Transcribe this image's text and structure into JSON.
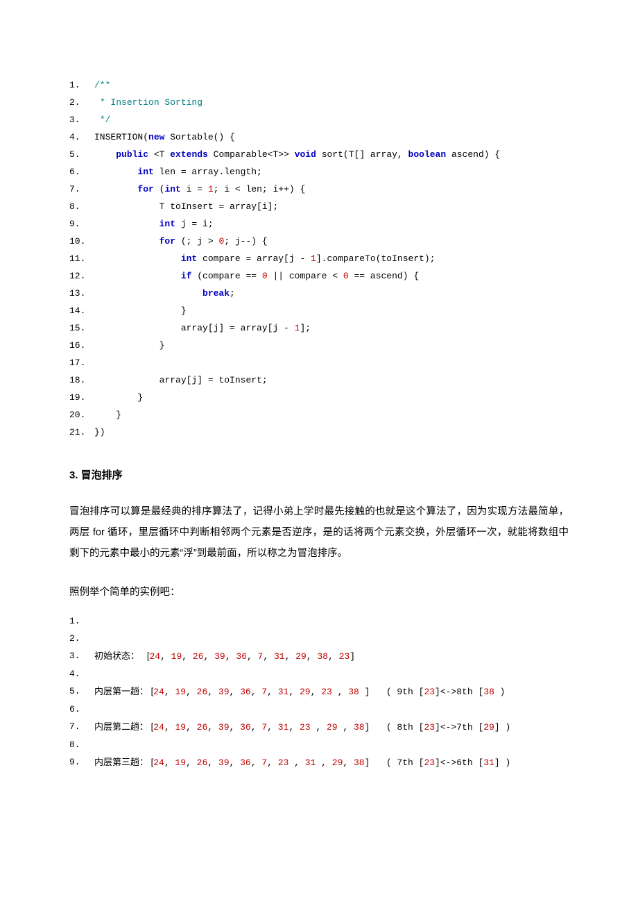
{
  "code1": {
    "lines": [
      {
        "n": "1.",
        "segs": [
          {
            "t": "/**",
            "c": "cmt"
          }
        ]
      },
      {
        "n": "2.",
        "segs": [
          {
            "t": " * Insertion Sorting",
            "c": "cmt"
          }
        ]
      },
      {
        "n": "3.",
        "segs": [
          {
            "t": " */",
            "c": "cmt"
          }
        ]
      },
      {
        "n": "4.",
        "segs": [
          {
            "t": "INSERTION("
          },
          {
            "t": "new",
            "c": "kw"
          },
          {
            "t": " Sortable() {"
          }
        ]
      },
      {
        "n": "5.",
        "segs": [
          {
            "t": "    "
          },
          {
            "t": "public",
            "c": "kw"
          },
          {
            "t": " <T "
          },
          {
            "t": "extends",
            "c": "kw"
          },
          {
            "t": " Comparable<T>> "
          },
          {
            "t": "void",
            "c": "kw"
          },
          {
            "t": " sort(T[] array, "
          },
          {
            "t": "boolean",
            "c": "kw"
          },
          {
            "t": " ascend) {"
          }
        ]
      },
      {
        "n": "6.",
        "segs": [
          {
            "t": "        "
          },
          {
            "t": "int",
            "c": "kw"
          },
          {
            "t": " len = array.length;"
          }
        ]
      },
      {
        "n": "7.",
        "segs": [
          {
            "t": "        "
          },
          {
            "t": "for",
            "c": "kw"
          },
          {
            "t": " ("
          },
          {
            "t": "int",
            "c": "kw"
          },
          {
            "t": " i = "
          },
          {
            "t": "1",
            "c": "num"
          },
          {
            "t": "; i < len; i++) {"
          }
        ]
      },
      {
        "n": "8.",
        "segs": [
          {
            "t": "            T toInsert = array[i];"
          }
        ]
      },
      {
        "n": "9.",
        "segs": [
          {
            "t": "            "
          },
          {
            "t": "int",
            "c": "kw"
          },
          {
            "t": " j = i;"
          }
        ]
      },
      {
        "n": "10.",
        "segs": [
          {
            "t": "            "
          },
          {
            "t": "for",
            "c": "kw"
          },
          {
            "t": " (; j > "
          },
          {
            "t": "0",
            "c": "num"
          },
          {
            "t": "; j--) {"
          }
        ]
      },
      {
        "n": "11.",
        "segs": [
          {
            "t": "                "
          },
          {
            "t": "int",
            "c": "kw"
          },
          {
            "t": " compare = array[j - "
          },
          {
            "t": "1",
            "c": "num"
          },
          {
            "t": "].compareTo(toInsert);"
          }
        ]
      },
      {
        "n": "12.",
        "segs": [
          {
            "t": "                "
          },
          {
            "t": "if",
            "c": "kw"
          },
          {
            "t": " (compare == "
          },
          {
            "t": "0",
            "c": "num"
          },
          {
            "t": " || compare < "
          },
          {
            "t": "0",
            "c": "num"
          },
          {
            "t": " == ascend) {"
          }
        ]
      },
      {
        "n": "13.",
        "segs": [
          {
            "t": "                    "
          },
          {
            "t": "break",
            "c": "kw"
          },
          {
            "t": ";"
          }
        ]
      },
      {
        "n": "14.",
        "segs": [
          {
            "t": "                }"
          }
        ]
      },
      {
        "n": "15.",
        "segs": [
          {
            "t": "                array[j] = array[j - "
          },
          {
            "t": "1",
            "c": "num"
          },
          {
            "t": "];"
          }
        ]
      },
      {
        "n": "16.",
        "segs": [
          {
            "t": "            }"
          }
        ]
      },
      {
        "n": "17.",
        "segs": [
          {
            "t": ""
          }
        ]
      },
      {
        "n": "18.",
        "segs": [
          {
            "t": "            array[j] = toInsert;"
          }
        ]
      },
      {
        "n": "19.",
        "segs": [
          {
            "t": "        }"
          }
        ]
      },
      {
        "n": "20.",
        "segs": [
          {
            "t": "    }"
          }
        ]
      },
      {
        "n": "21.",
        "segs": [
          {
            "t": "})"
          }
        ]
      }
    ]
  },
  "section": {
    "title": "3.  冒泡排序",
    "para1": "冒泡排序可以算是最经典的排序算法了，记得小弟上学时最先接触的也就是这个算法了，因为实现方法最简单，两层 for 循环，里层循环中判断相邻两个元素是否逆序，是的话将两个元素交换，外层循环一次，就能将数组中剩下的元素中最小的元素“浮”到最前面，所以称之为冒泡排序。",
    "para2": "照例举个简单的实例吧："
  },
  "trace": {
    "lines": [
      {
        "n": "1.",
        "segs": []
      },
      {
        "n": "2.",
        "segs": []
      },
      {
        "n": "3.",
        "segs": [
          {
            "t": "初始状态：   [",
            "c": "trlabel"
          },
          {
            "t": "24",
            "c": "num"
          },
          {
            "t": ", "
          },
          {
            "t": "19",
            "c": "num"
          },
          {
            "t": ", "
          },
          {
            "t": "26",
            "c": "num"
          },
          {
            "t": ", "
          },
          {
            "t": "39",
            "c": "num"
          },
          {
            "t": ", "
          },
          {
            "t": "36",
            "c": "num"
          },
          {
            "t": ", "
          },
          {
            "t": "7",
            "c": "num"
          },
          {
            "t": ", "
          },
          {
            "t": "31",
            "c": "num"
          },
          {
            "t": ", "
          },
          {
            "t": "29",
            "c": "num"
          },
          {
            "t": ", "
          },
          {
            "t": "38",
            "c": "num"
          },
          {
            "t": ", "
          },
          {
            "t": "23",
            "c": "num"
          },
          {
            "t": "]"
          }
        ]
      },
      {
        "n": "4.",
        "segs": []
      },
      {
        "n": "5.",
        "segs": [
          {
            "t": "内层第一趟： [",
            "c": "trlabel"
          },
          {
            "t": "24",
            "c": "num"
          },
          {
            "t": ", "
          },
          {
            "t": "19",
            "c": "num"
          },
          {
            "t": ", "
          },
          {
            "t": "26",
            "c": "num"
          },
          {
            "t": ", "
          },
          {
            "t": "39",
            "c": "num"
          },
          {
            "t": ", "
          },
          {
            "t": "36",
            "c": "num"
          },
          {
            "t": ", "
          },
          {
            "t": "7",
            "c": "num"
          },
          {
            "t": ", "
          },
          {
            "t": "31",
            "c": "num"
          },
          {
            "t": ", "
          },
          {
            "t": "29",
            "c": "num"
          },
          {
            "t": ", "
          },
          {
            "t": "23",
            "c": "num"
          },
          {
            "t": " , "
          },
          {
            "t": "38",
            "c": "num"
          },
          {
            "t": " ]   ( 9th ["
          },
          {
            "t": "23",
            "c": "num"
          },
          {
            "t": "]<->8th ["
          },
          {
            "t": "38",
            "c": "num"
          },
          {
            "t": " )"
          }
        ]
      },
      {
        "n": "6.",
        "segs": []
      },
      {
        "n": "7.",
        "segs": [
          {
            "t": "内层第二趟： [",
            "c": "trlabel"
          },
          {
            "t": "24",
            "c": "num"
          },
          {
            "t": ", "
          },
          {
            "t": "19",
            "c": "num"
          },
          {
            "t": ", "
          },
          {
            "t": "26",
            "c": "num"
          },
          {
            "t": ", "
          },
          {
            "t": "39",
            "c": "num"
          },
          {
            "t": ", "
          },
          {
            "t": "36",
            "c": "num"
          },
          {
            "t": ", "
          },
          {
            "t": "7",
            "c": "num"
          },
          {
            "t": ", "
          },
          {
            "t": "31",
            "c": "num"
          },
          {
            "t": ", "
          },
          {
            "t": "23",
            "c": "num"
          },
          {
            "t": " , "
          },
          {
            "t": "29",
            "c": "num"
          },
          {
            "t": " , "
          },
          {
            "t": "38",
            "c": "num"
          },
          {
            "t": "]   ( 8th ["
          },
          {
            "t": "23",
            "c": "num"
          },
          {
            "t": "]<->7th ["
          },
          {
            "t": "29",
            "c": "num"
          },
          {
            "t": "] )"
          }
        ]
      },
      {
        "n": "8.",
        "segs": []
      },
      {
        "n": "9.",
        "segs": [
          {
            "t": "内层第三趟： [",
            "c": "trlabel"
          },
          {
            "t": "24",
            "c": "num"
          },
          {
            "t": ", "
          },
          {
            "t": "19",
            "c": "num"
          },
          {
            "t": ", "
          },
          {
            "t": "26",
            "c": "num"
          },
          {
            "t": ", "
          },
          {
            "t": "39",
            "c": "num"
          },
          {
            "t": ", "
          },
          {
            "t": "36",
            "c": "num"
          },
          {
            "t": ", "
          },
          {
            "t": "7",
            "c": "num"
          },
          {
            "t": ", "
          },
          {
            "t": "23",
            "c": "num"
          },
          {
            "t": " , "
          },
          {
            "t": "31",
            "c": "num"
          },
          {
            "t": " , "
          },
          {
            "t": "29",
            "c": "num"
          },
          {
            "t": ", "
          },
          {
            "t": "38",
            "c": "num"
          },
          {
            "t": "]   ( 7th ["
          },
          {
            "t": "23",
            "c": "num"
          },
          {
            "t": "]<->6th ["
          },
          {
            "t": "31",
            "c": "num"
          },
          {
            "t": "] )"
          }
        ]
      }
    ]
  }
}
